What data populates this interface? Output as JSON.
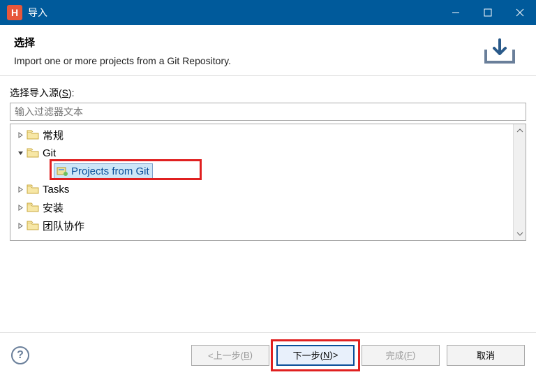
{
  "window": {
    "app_letter": "H",
    "title": "导入"
  },
  "header": {
    "title": "选择",
    "description": "Import one or more projects from a Git Repository."
  },
  "source": {
    "label_prefix": "选择导入源(",
    "label_mnemonic": "S",
    "label_suffix": "):",
    "filter_placeholder": "输入过滤器文本"
  },
  "tree": {
    "items": [
      {
        "label": "常规",
        "expanded": false,
        "depth": 0
      },
      {
        "label": "Git",
        "expanded": true,
        "depth": 0
      },
      {
        "label": "Projects from Git",
        "depth": 1,
        "selected": true,
        "leaf": true
      },
      {
        "label": "Tasks",
        "expanded": false,
        "depth": 0
      },
      {
        "label": "安装",
        "expanded": false,
        "depth": 0
      },
      {
        "label": "团队协作",
        "expanded": false,
        "depth": 0
      }
    ]
  },
  "buttons": {
    "back_prefix": "<上一步(",
    "back_mnemonic": "B",
    "back_suffix": ")",
    "next_prefix": "下一步(",
    "next_mnemonic": "N",
    "next_suffix": ")>",
    "finish_prefix": "完成(",
    "finish_mnemonic": "F",
    "finish_suffix": ")",
    "cancel": "取消"
  }
}
